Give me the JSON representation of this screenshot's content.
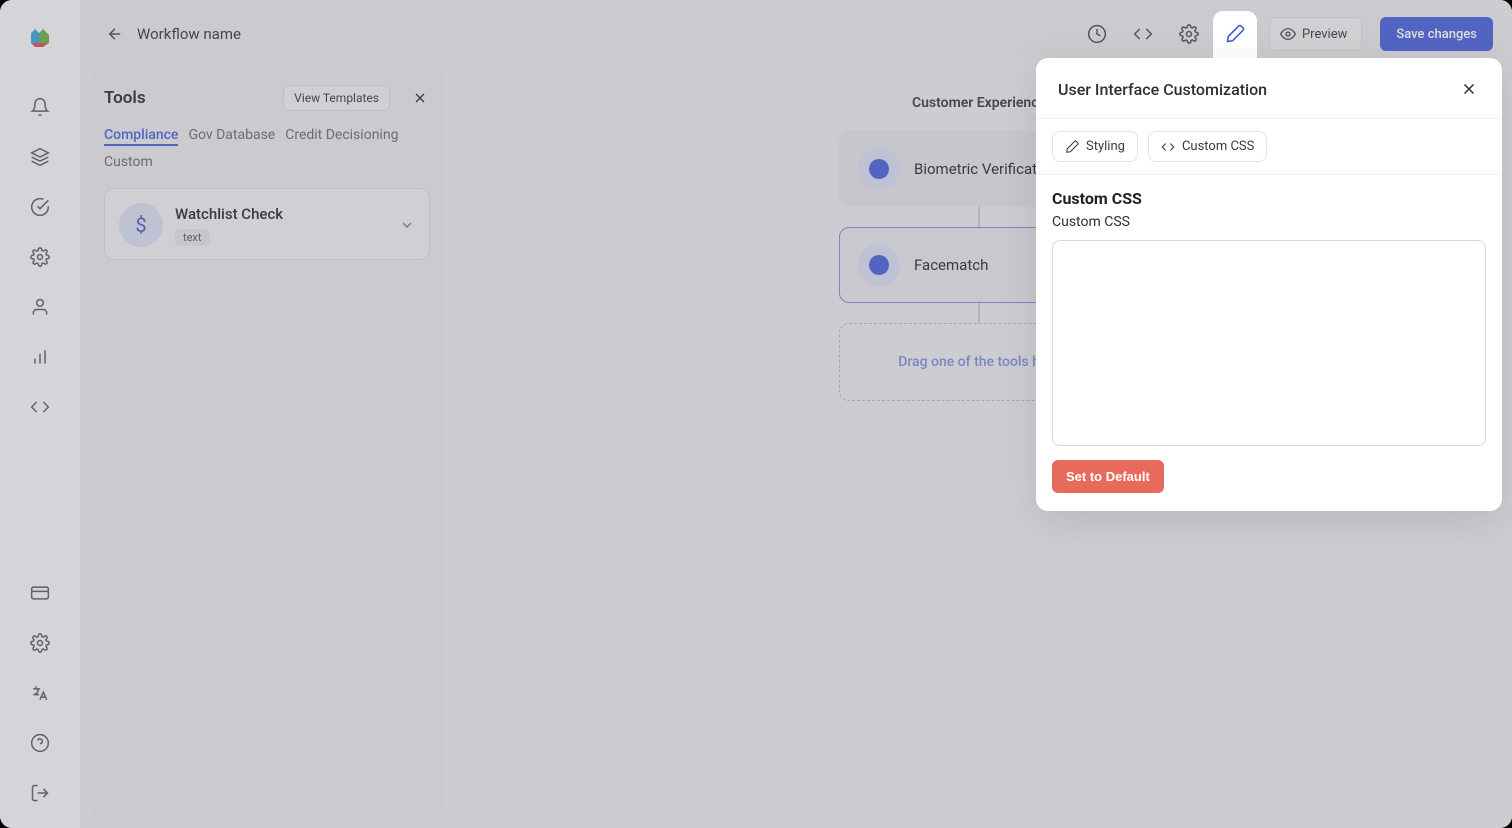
{
  "topbar": {
    "workflow_name": "Workflow name",
    "preview_label": "Preview",
    "save_label": "Save changes"
  },
  "tools_panel": {
    "title": "Tools",
    "view_templates_label": "View Templates",
    "tabs": {
      "compliance": "Compliance",
      "gov_database": "Gov Database",
      "credit": "Credit Decisioning",
      "custom": "Custom"
    },
    "tool_card": {
      "title": "Watchlist Check",
      "badge": "text",
      "icon_char": "$"
    }
  },
  "canvas": {
    "heading": "Customer Experience",
    "node1": "Biometric Verification",
    "node2": "Facematch",
    "dropzone": "Drag one of the tools here"
  },
  "ui_panel": {
    "title": "User Interface Customization",
    "subtab_styling": "Styling",
    "subtab_custom_css": "Custom CSS",
    "section_heading": "Custom CSS",
    "field_label": "Custom CSS",
    "default_label": "Set to Default"
  }
}
